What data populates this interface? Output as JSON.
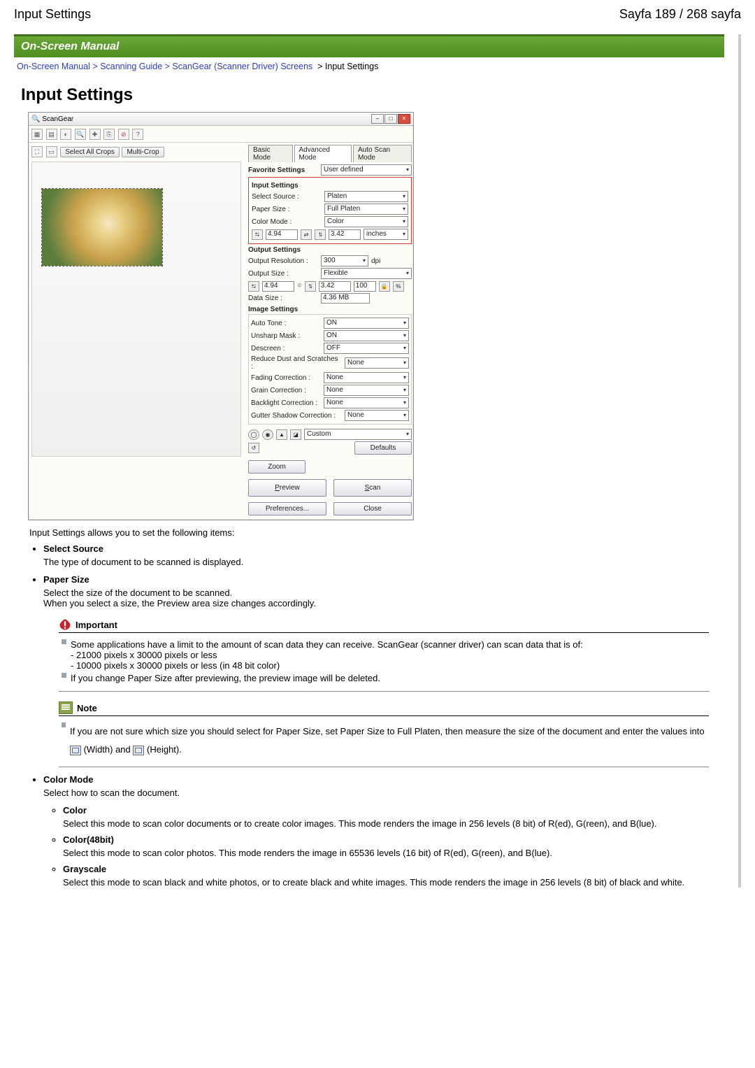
{
  "header": {
    "left": "Input Settings",
    "right": "Sayfa 189 / 268 sayfa"
  },
  "banner": "On-Screen Manual",
  "breadcrumb": {
    "a1": "On-Screen Manual",
    "a2": "Scanning Guide",
    "a3": "ScanGear (Scanner Driver) Screens",
    "current": "Input Settings"
  },
  "title": "Input Settings",
  "sg": {
    "window_title": "ScanGear",
    "left_btn1": "Select All Crops",
    "left_btn2": "Multi-Crop",
    "tabs": {
      "t1": "Basic Mode",
      "t2": "Advanced Mode",
      "t3": "Auto Scan Mode"
    },
    "fav_label": "Favorite Settings",
    "fav_val": "User defined",
    "input_sec": "Input Settings",
    "select_source_l": "Select Source :",
    "select_source_v": "Platen",
    "paper_size_l": "Paper Size :",
    "paper_size_v": "Full Platen",
    "color_mode_l": "Color Mode :",
    "color_mode_v": "Color",
    "w_val": "4.94",
    "h_val": "3.42",
    "unit_v": "inches",
    "output_sec": "Output Settings",
    "out_res_l": "Output Resolution :",
    "out_res_v": "300",
    "out_res_unit": "dpi",
    "out_size_l": "Output Size :",
    "out_size_v": "Flexible",
    "ow_val": "4.94",
    "oh_val": "3.42",
    "pct_val": "100",
    "data_size_l": "Data Size :",
    "data_size_v": "4.36 MB",
    "image_sec": "Image Settings",
    "auto_tone_l": "Auto Tone :",
    "auto_tone_v": "ON",
    "unsharp_l": "Unsharp Mask :",
    "unsharp_v": "ON",
    "descreen_l": "Descreen :",
    "descreen_v": "OFF",
    "dust_l": "Reduce Dust and Scratches :",
    "dust_v": "None",
    "fading_l": "Fading Correction :",
    "fading_v": "None",
    "grain_l": "Grain Correction :",
    "grain_v": "None",
    "backlight_l": "Backlight Correction :",
    "backlight_v": "None",
    "gutter_l": "Gutter Shadow Correction :",
    "gutter_v": "None",
    "custom_v": "Custom",
    "defaults_btn": "Defaults",
    "zoom_btn": "Zoom",
    "preview_btn": "Preview",
    "scan_btn": "Scan",
    "prefs_btn": "Preferences...",
    "close_btn": "Close"
  },
  "intro": "Input Settings allows you to set the following items:",
  "items": {
    "select_source": {
      "title": "Select Source",
      "body": "The type of document to be scanned is displayed."
    },
    "paper_size": {
      "title": "Paper Size",
      "body1": "Select the size of the document to be scanned.",
      "body2": "When you select a size, the Preview area size changes accordingly."
    },
    "color_mode": {
      "title": "Color Mode",
      "body": "Select how to scan the document.",
      "color": {
        "title": "Color",
        "body": "Select this mode to scan color documents or to create color images. This mode renders the image in 256 levels (8 bit) of R(ed), G(reen), and B(lue)."
      },
      "color48": {
        "title": "Color(48bit)",
        "body": "Select this mode to scan color photos. This mode renders the image in 65536 levels (16 bit) of R(ed), G(reen), and B(lue)."
      },
      "gray": {
        "title": "Grayscale",
        "body": "Select this mode to scan black and white photos, or to create black and white images. This mode renders the image in 256 levels (8 bit) of black and white."
      }
    }
  },
  "important": {
    "label": "Important",
    "l1": "Some applications have a limit to the amount of scan data they can receive. ScanGear (scanner driver) can scan data that is of:",
    "l1a": "- 21000 pixels x 30000 pixels or less",
    "l1b": "- 10000 pixels x 30000 pixels or less (in 48 bit color)",
    "l2": "If you change Paper Size after previewing, the preview image will be deleted."
  },
  "note": {
    "label": "Note",
    "l1a": "If you are not sure which size you should select for Paper Size, set Paper Size to Full Platen, then",
    "l1b": "measure the size of the document and enter the values into ",
    "l1c": " (Width) and ",
    "l1d": " (Height)."
  }
}
